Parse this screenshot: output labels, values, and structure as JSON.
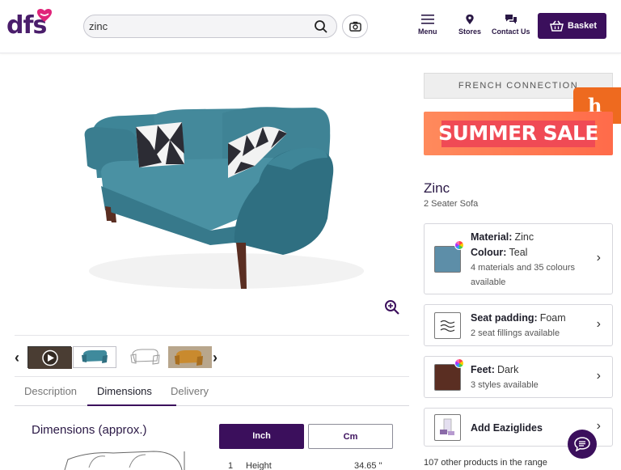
{
  "header": {
    "logo_text": "dfs",
    "search_value": "zinc",
    "nav": [
      {
        "label": "Menu",
        "icon": "hamburger-icon"
      },
      {
        "label": "Stores",
        "icon": "location-pin-icon"
      },
      {
        "label": "Contact Us",
        "icon": "chat-icon"
      }
    ],
    "basket_label": "Basket"
  },
  "gallery": {
    "thumbnails": [
      "video",
      "teal sofa",
      "sofa sketch",
      "mustard sofa"
    ]
  },
  "tabs": [
    "Description",
    "Dimensions",
    "Delivery"
  ],
  "active_tab": "Dimensions",
  "dimensions": {
    "title": "Dimensions (approx.)",
    "unit_inch": "Inch",
    "unit_cm": "Cm",
    "rows": [
      {
        "num": "1",
        "label": "Height",
        "value": "34.65 \""
      }
    ]
  },
  "sidebar": {
    "brand_banner": "FRENCH CONNECTION",
    "sale_banner": "SUMMER SALE",
    "product_name": "Zinc",
    "product_sub": "2 Seater Sofa",
    "options": [
      {
        "line1_label": "Material:",
        "line1_value": "Zinc",
        "line2_label": "Colour:",
        "line2_value": "Teal",
        "detail": "4 materials and 35 colours available"
      },
      {
        "line1_label": "Seat padding:",
        "line1_value": "Foam",
        "detail": "2 seat fillings available"
      },
      {
        "line1_label": "Feet:",
        "line1_value": "Dark",
        "detail": "3 styles available"
      },
      {
        "line1_label": "Add Eaziglides"
      }
    ],
    "other_products": "107 other products in the range"
  },
  "colors": {
    "brand_purple": "#3b0f5c",
    "sofa_teal": "#3f8a9c",
    "sale_orange": "#ff6b4a",
    "honey_orange": "#ee6a1f",
    "feet_brown": "#5a2e22"
  }
}
